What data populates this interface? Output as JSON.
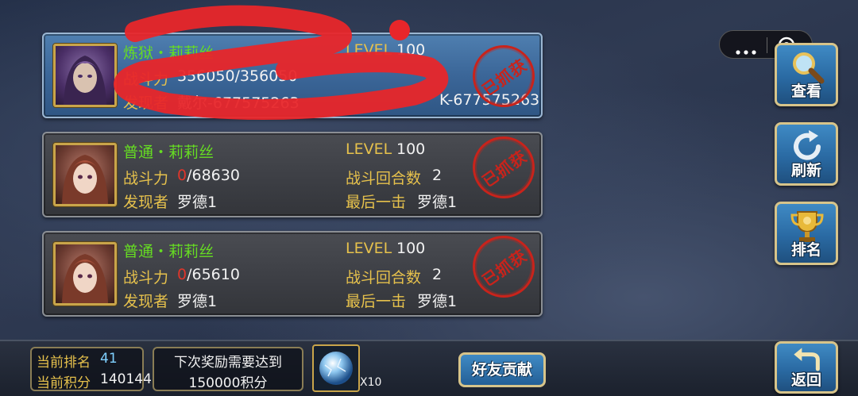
{
  "cards": [
    {
      "name": "炼狱・莉莉丝",
      "power_label": "战斗力",
      "power_current": "356050",
      "power_total": "/356050",
      "finder_label": "发现者",
      "finder": "戴尔-677575263",
      "level_label": "LEVEL",
      "level": "100",
      "last_hit_value": "K-677575263",
      "stamp": "已抓获"
    },
    {
      "name": "普通・莉莉丝",
      "power_label": "战斗力",
      "power_current": "0",
      "power_total": "/68630",
      "finder_label": "发现者",
      "finder": "罗德1",
      "level_label": "LEVEL",
      "level": "100",
      "rounds_label": "战斗回合数",
      "rounds": "2",
      "last_hit_label": "最后一击",
      "last_hit": "罗德1",
      "stamp": "已抓获"
    },
    {
      "name": "普通・莉莉丝",
      "power_label": "战斗力",
      "power_current": "0",
      "power_total": "/65610",
      "finder_label": "发现者",
      "finder": "罗德1",
      "level_label": "LEVEL",
      "level": "100",
      "rounds_label": "战斗回合数",
      "rounds": "2",
      "last_hit_label": "最后一击",
      "last_hit": "罗德1",
      "stamp": "已抓获"
    }
  ],
  "sidebar": {
    "view": "查看",
    "refresh": "刷新",
    "rank": "排名",
    "back": "返回"
  },
  "bottom": {
    "rank_label": "当前排名",
    "rank_value": "41",
    "score_label": "当前积分",
    "score_value": "140144",
    "next_reward_line1": "下次奖励需要达到",
    "next_reward_line2": "150000积分",
    "item_count": "X10",
    "friend_button": "好友贡献"
  },
  "icons": [
    "more-icon",
    "target-icon",
    "magnifier-icon",
    "refresh-icon",
    "trophy-icon",
    "return-arrow-icon",
    "crystal-orb-icon"
  ],
  "colors": {
    "name_green": "#66dd22",
    "label_gold": "#e6c14c",
    "stamp_red": "#c9231b",
    "card_blue": "#3b6698"
  }
}
